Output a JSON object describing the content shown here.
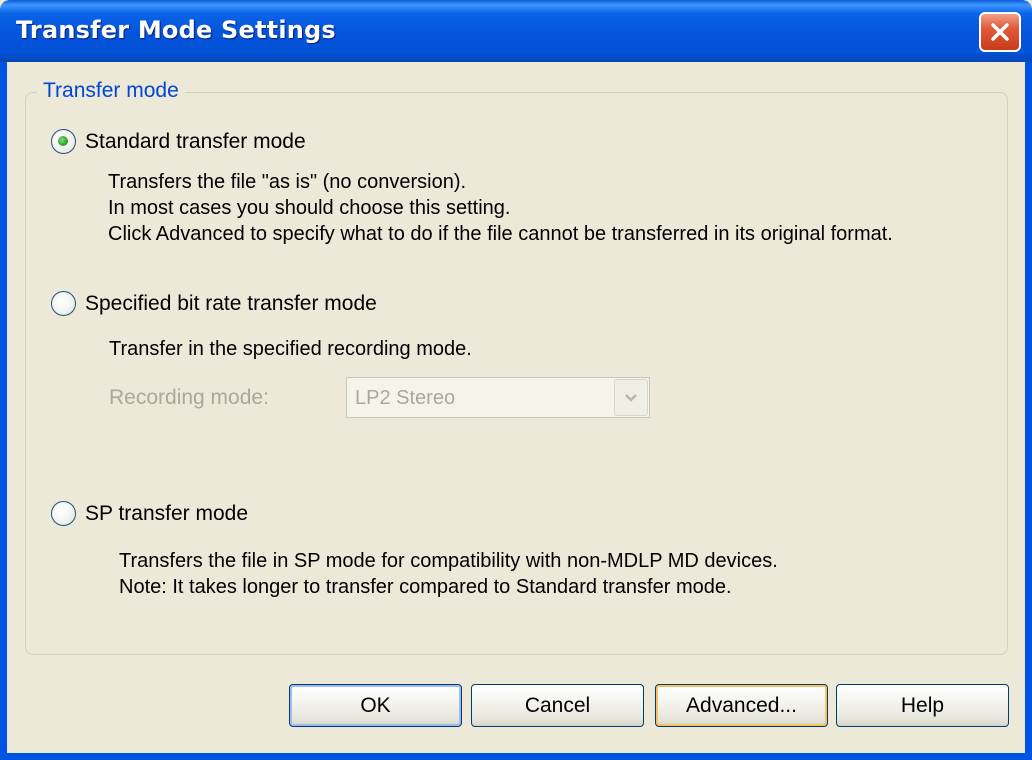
{
  "window": {
    "title": "Transfer Mode Settings"
  },
  "group": {
    "legend": "Transfer mode",
    "options": [
      {
        "label": "Standard transfer mode",
        "checked": true,
        "description": [
          "Transfers the file \"as is\" (no conversion).",
          "In most cases you should choose this setting.",
          "Click Advanced to specify what to do if the file cannot be transferred in its original format."
        ]
      },
      {
        "label": "Specified bit rate transfer mode",
        "checked": false,
        "description": [
          "Transfer in the specified recording mode."
        ],
        "recording_mode_label": "Recording mode:",
        "recording_mode_value": "LP2 Stereo",
        "enabled": false
      },
      {
        "label": "SP transfer mode",
        "checked": false,
        "description": [
          "Transfers the file in SP mode for compatibility with non-MDLP MD devices.",
          "Note: It takes longer to transfer compared to Standard transfer mode."
        ]
      }
    ]
  },
  "buttons": {
    "ok": "OK",
    "cancel": "Cancel",
    "advanced": "Advanced...",
    "help": "Help"
  },
  "icons": {
    "close": "close-icon",
    "dropdown": "chevron-down-icon"
  },
  "colors": {
    "title_bar": "#0454dd",
    "group_legend": "#0046d5",
    "disabled_text": "#aca899",
    "checked_radio": "#2fa22a"
  }
}
